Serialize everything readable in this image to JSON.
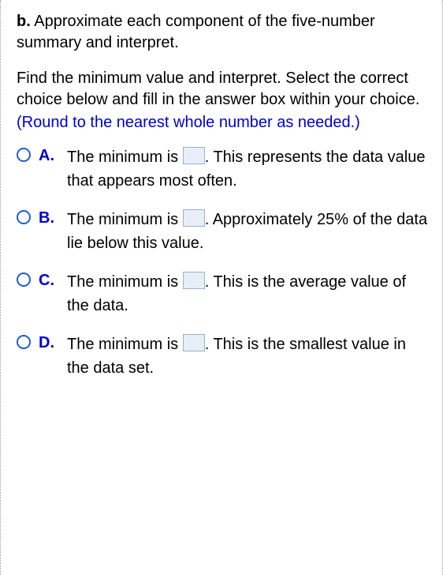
{
  "part_label": "b.",
  "intro": "Approximate each component of the five-number summary and interpret.",
  "find": "Find the minimum value and interpret. Select the correct choice below and fill in the answer box within your choice.",
  "round_note": "(Round to the nearest whole number as needed.)",
  "choices": [
    {
      "label": "A.",
      "pre": "The minimum is ",
      "post": ". This represents the data value that appears most often."
    },
    {
      "label": "B.",
      "pre": "The minimum is ",
      "post": ". Approximately 25% of the data lie below this value."
    },
    {
      "label": "C.",
      "pre": "The minimum is ",
      "post": ". This is the average value of the data."
    },
    {
      "label": "D.",
      "pre": "The minimum is ",
      "post": ". This is the smallest value in the data set."
    }
  ]
}
